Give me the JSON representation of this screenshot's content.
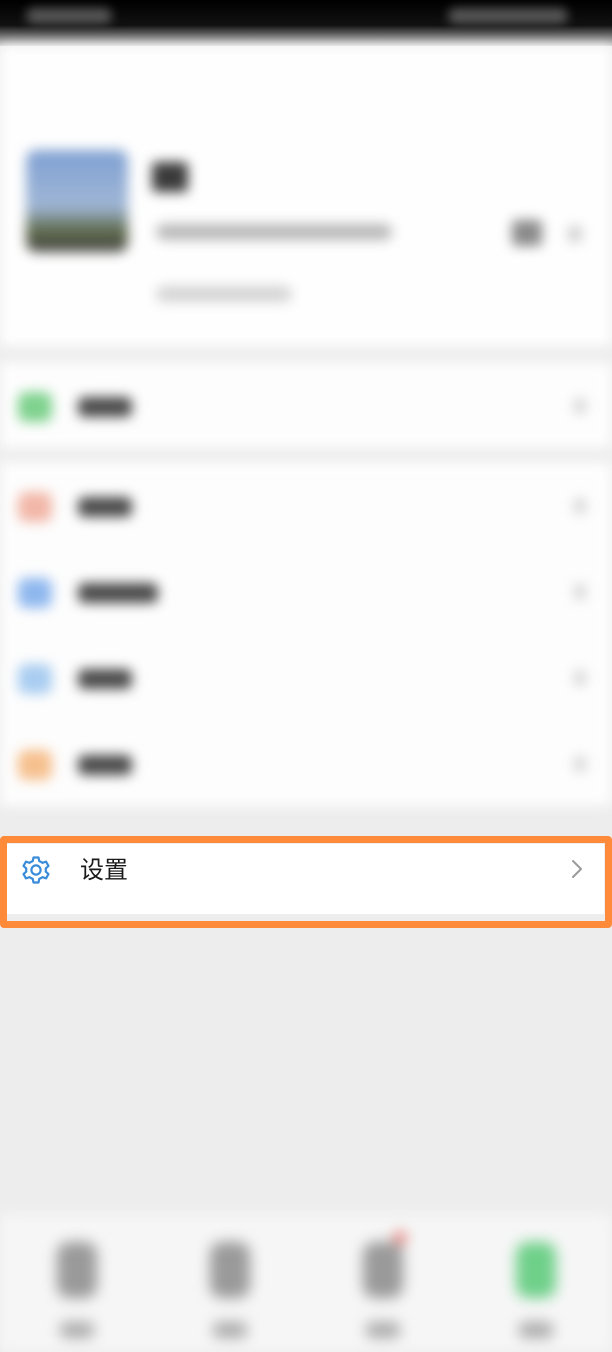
{
  "settings": {
    "label": "设置",
    "icon": "gear-icon",
    "chevron_icon": "chevron-right-icon"
  },
  "colors": {
    "highlight_border": "#ff8a3a",
    "gear_icon": "#3a8bd9",
    "background": "#ededed"
  }
}
